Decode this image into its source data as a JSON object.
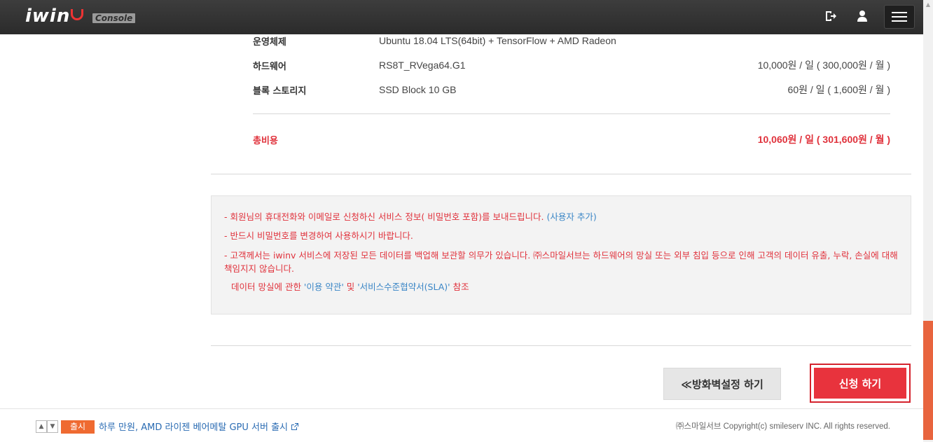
{
  "header": {
    "logo_text": "iwin",
    "console_badge": "Console",
    "icons": [
      "logout-icon",
      "user-icon",
      "hamburger-menu-icon"
    ]
  },
  "specs": [
    {
      "label": "운영체제",
      "value": "Ubuntu 18.04 LTS(64bit) + TensorFlow + AMD Radeon",
      "price": ""
    },
    {
      "label": "하드웨어",
      "value": "RS8T_RVega64.G1",
      "price": "10,000원 / 일 ( 300,000원 / 월 )"
    },
    {
      "label": "블록 스토리지",
      "value": "SSD Block 10 GB",
      "price": "60원 / 일 ( 1,600원 / 월 )"
    }
  ],
  "total": {
    "label": "총비용",
    "price": "10,060원 / 일 ( 301,600원 / 월 )"
  },
  "notice": {
    "line1": "- 회원님의 휴대전화와 이메일로 신청하신 서비스 정보(         비밀번호 포함)를 보내드립니다.",
    "line1_link": "(사용자 추가)",
    "line2": "- 반드시         비밀번호를 변경하여 사용하시기 바랍니다.",
    "line3": "- 고객께서는 iwinv 서비스에 저장된 모든 데이터를 백업해 보관할 의무가 있습니다. ㈜스마일서브는 하드웨어의 망실 또는 외부 침입 등으로 인해 고객의 데이터 유출, 누락, 손실에 대해 책임지지 않습니다.",
    "line4_prefix": "데이터 망실에 관한 ",
    "line4_link1": "'이용 약관'",
    "line4_mid": " 및 ",
    "line4_link2": "'서비스수준협약서(SLA)'",
    "line4_suffix": " 참조"
  },
  "buttons": {
    "firewall": "≪방화벽설정 하기",
    "apply": "신청 하기"
  },
  "footer": {
    "badge": "출시",
    "news": "하루 만원, AMD 라이젠 베어메탈 GPU 서버 출시",
    "copyright": "㈜스마일서브 Copyright(c) smileserv INC. All rights reserved."
  },
  "colors": {
    "accent_red": "#e8333d",
    "badge_orange": "#ef6a31",
    "link_blue": "#3a86c6"
  }
}
